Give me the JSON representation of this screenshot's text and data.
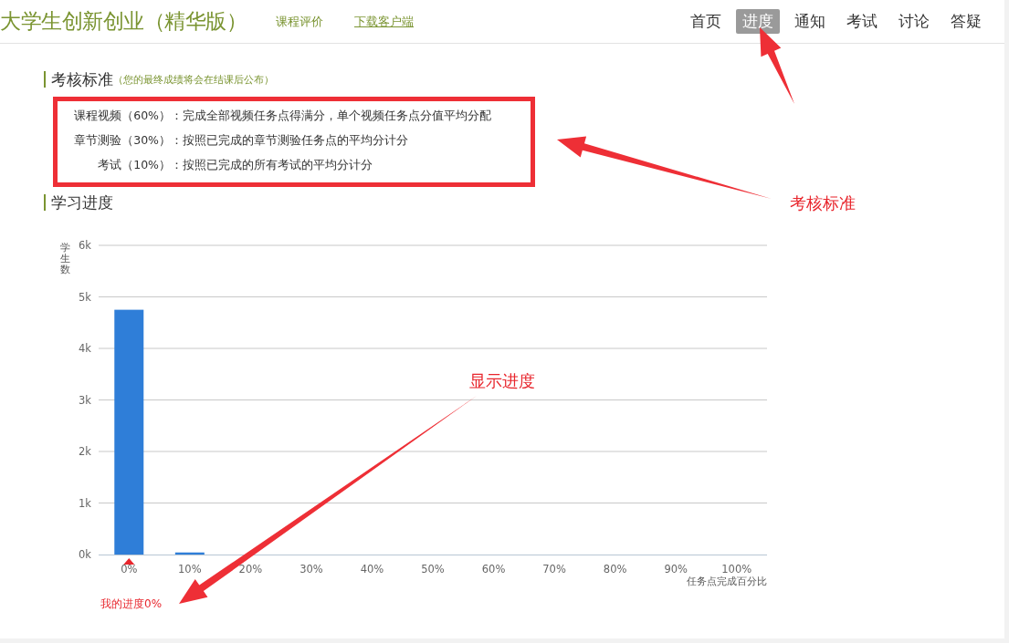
{
  "header": {
    "title": "大学生创新创业（精华版）",
    "links": [
      {
        "label": "课程评价",
        "underlined": false
      },
      {
        "label": "下载客户端",
        "underlined": true
      }
    ],
    "nav": [
      {
        "label": "首页",
        "selected": false
      },
      {
        "label": "进度",
        "selected": true
      },
      {
        "label": "通知",
        "selected": false
      },
      {
        "label": "考试",
        "selected": false
      },
      {
        "label": "讨论",
        "selected": false
      },
      {
        "label": "答疑",
        "selected": false
      }
    ]
  },
  "criteria": {
    "title": "考核标准",
    "note": "（您的最终成绩将会在结课后公布）",
    "items": [
      {
        "name": "课程视频（60%）",
        "desc": "：完成全部视频任务点得满分，单个视频任务点分值平均分配"
      },
      {
        "name": "章节测验（30%）",
        "desc": "：按照已完成的章节测验任务点的平均分计分"
      },
      {
        "name": "考试（10%）",
        "desc": "：按照已完成的所有考试的平均分计分"
      }
    ]
  },
  "progress": {
    "title": "学习进度",
    "chart_data": {
      "type": "bar",
      "ylabel": "学生数",
      "xlabel": "任务点完成百分比",
      "categories": [
        "0%",
        "10%",
        "20%",
        "30%",
        "40%",
        "50%",
        "60%",
        "70%",
        "80%",
        "90%",
        "100%"
      ],
      "values": [
        4750,
        40,
        0,
        0,
        0,
        0,
        0,
        0,
        0,
        0,
        0
      ],
      "ylim": [
        0,
        6000
      ],
      "grid": true,
      "yticks": [
        {
          "value": 0,
          "label": "0k"
        },
        {
          "value": 1000,
          "label": "1k"
        },
        {
          "value": 2000,
          "label": "2k"
        },
        {
          "value": 3000,
          "label": "3k"
        },
        {
          "value": 4000,
          "label": "4k"
        },
        {
          "value": 5000,
          "label": "5k"
        },
        {
          "value": 6000,
          "label": "6k"
        }
      ]
    },
    "my_progress": "我的进度0%"
  },
  "annotations": [
    {
      "text": "考核标准"
    },
    {
      "text": "显示进度"
    }
  ]
}
